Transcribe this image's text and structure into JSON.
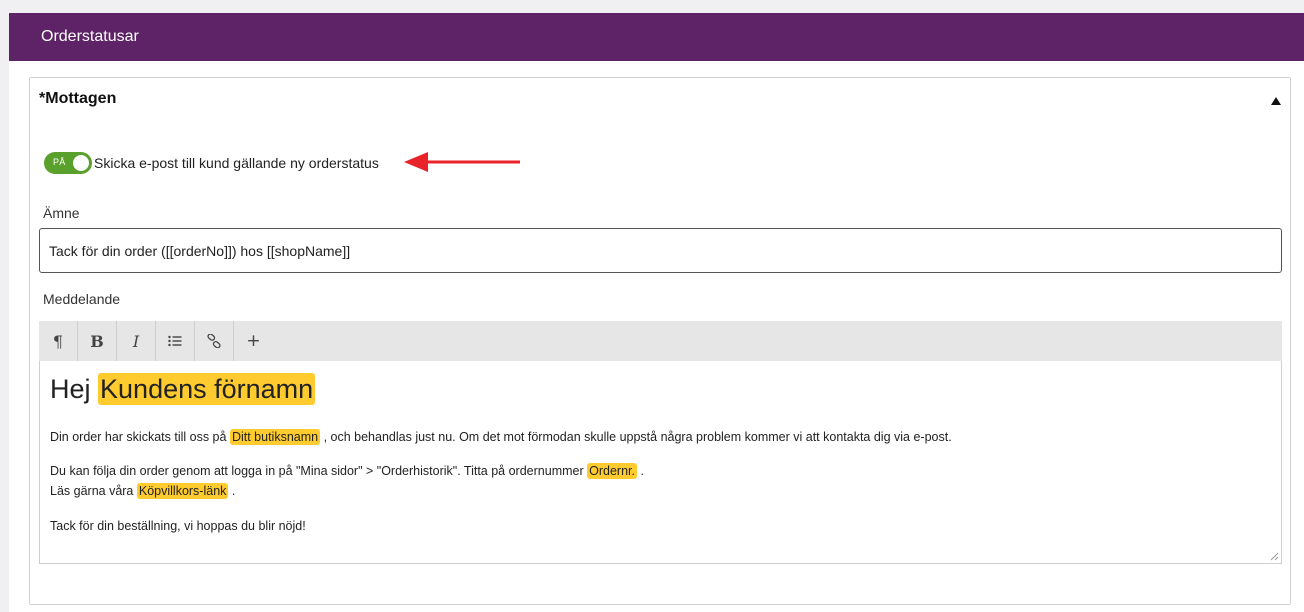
{
  "header": {
    "title": "Orderstatusar"
  },
  "card": {
    "required_mark": "*",
    "title": "Mottagen",
    "toggle": {
      "state_label": "PÅ",
      "text": "Skicka e-post till kund gällande ny orderstatus",
      "on": true
    },
    "subject": {
      "label": "Ämne",
      "value": "Tack för din order ([[orderNo]]) hos [[shopName]]"
    },
    "message": {
      "label": "Meddelande",
      "toolbar": [
        "¶",
        "B",
        "I",
        "list",
        "link",
        "+"
      ],
      "heading_prefix": "Hej",
      "heading_token": "Kundens förnamn",
      "line1_a": "Din order har skickats till oss på",
      "line1_token": "Ditt butiksnamn",
      "line1_b": ", och behandlas just nu. Om det mot förmodan skulle uppstå några problem kommer vi att kontakta dig via e-post.",
      "line2_a": "Du kan följa din order genom att logga in på \"Mina sidor\" > \"Orderhistorik\". Titta på ordernummer",
      "line2_token": "Ordernr.",
      "line2_b": ".",
      "line3_a": "Läs gärna våra",
      "line3_token": "Köpvillkors-länk",
      "line3_b": ".",
      "line4": "Tack för din beställning, vi hoppas du blir nöjd!"
    }
  },
  "colors": {
    "header_bg": "#5e2366",
    "toggle_on": "#5aa02c",
    "token_highlight": "#ffcb2f",
    "arrow": "#e8232a"
  }
}
